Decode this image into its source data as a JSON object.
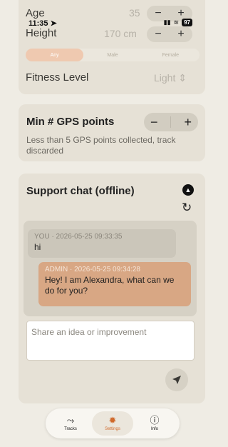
{
  "status_bar": {
    "time": "11:35",
    "battery": "97"
  },
  "profile": {
    "age_label": "Age",
    "age_value": "35",
    "height_label": "Height",
    "height_value": "170 cm",
    "gender_options": [
      "Any",
      "Male",
      "Female"
    ],
    "gender_selected": "Any",
    "fitness_label": "Fitness Level",
    "fitness_value": "Light"
  },
  "gps": {
    "title": "Min # GPS points",
    "description": "Less than 5 GPS points collected, track discarded"
  },
  "chat": {
    "title": "Support chat (offline)",
    "messages": [
      {
        "meta": "YOU · 2026-05-25 09:33:35",
        "text": "hi"
      },
      {
        "meta": "ADMIN · 2026-05-25 09:34:28",
        "text": "Hey! I am Alexandra, what can we do for you?"
      }
    ],
    "input_placeholder": "Share an idea or improvement"
  },
  "tabs": [
    {
      "label": "Tracks",
      "icon": "route-icon"
    },
    {
      "label": "Settings",
      "icon": "gear-icon",
      "active": true
    },
    {
      "label": "Info",
      "icon": "info-icon"
    }
  ],
  "colors": {
    "accent": "#d06a2c",
    "admin_bubble": "#d8a784",
    "background": "#efece4"
  }
}
